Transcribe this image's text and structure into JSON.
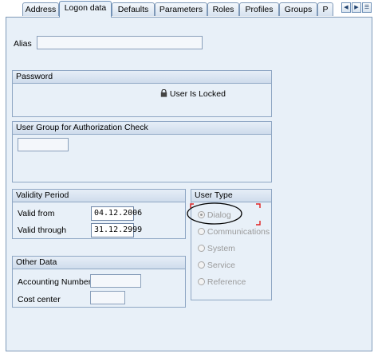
{
  "tabs": [
    {
      "label": "Address",
      "active": false
    },
    {
      "label": "Logon data",
      "active": true
    },
    {
      "label": "Defaults",
      "active": false
    },
    {
      "label": "Parameters",
      "active": false
    },
    {
      "label": "Roles",
      "active": false
    },
    {
      "label": "Profiles",
      "active": false
    },
    {
      "label": "Groups",
      "active": false
    },
    {
      "label": "P",
      "active": false
    }
  ],
  "alias": {
    "label": "Alias",
    "value": ""
  },
  "password": {
    "title": "Password",
    "status": "User Is Locked"
  },
  "user_group": {
    "title": "User Group for Authorization Check",
    "value": ""
  },
  "validity": {
    "title": "Validity Period",
    "valid_from_label": "Valid from",
    "valid_from_value": "04.12.2006",
    "valid_through_label": "Valid through",
    "valid_through_value": "31.12.2999"
  },
  "other_data": {
    "title": "Other Data",
    "accounting_label": "Accounting Number",
    "accounting_value": "",
    "cost_center_label": "Cost center",
    "cost_center_value": ""
  },
  "user_type": {
    "title": "User Type",
    "options": [
      "Dialog",
      "Communications",
      "System",
      "Service",
      "Reference"
    ],
    "selected": "Dialog"
  },
  "colors": {
    "panel_bg": "#e8f0f8",
    "border": "#8fa7c4",
    "annotation_red": "#e02020"
  }
}
